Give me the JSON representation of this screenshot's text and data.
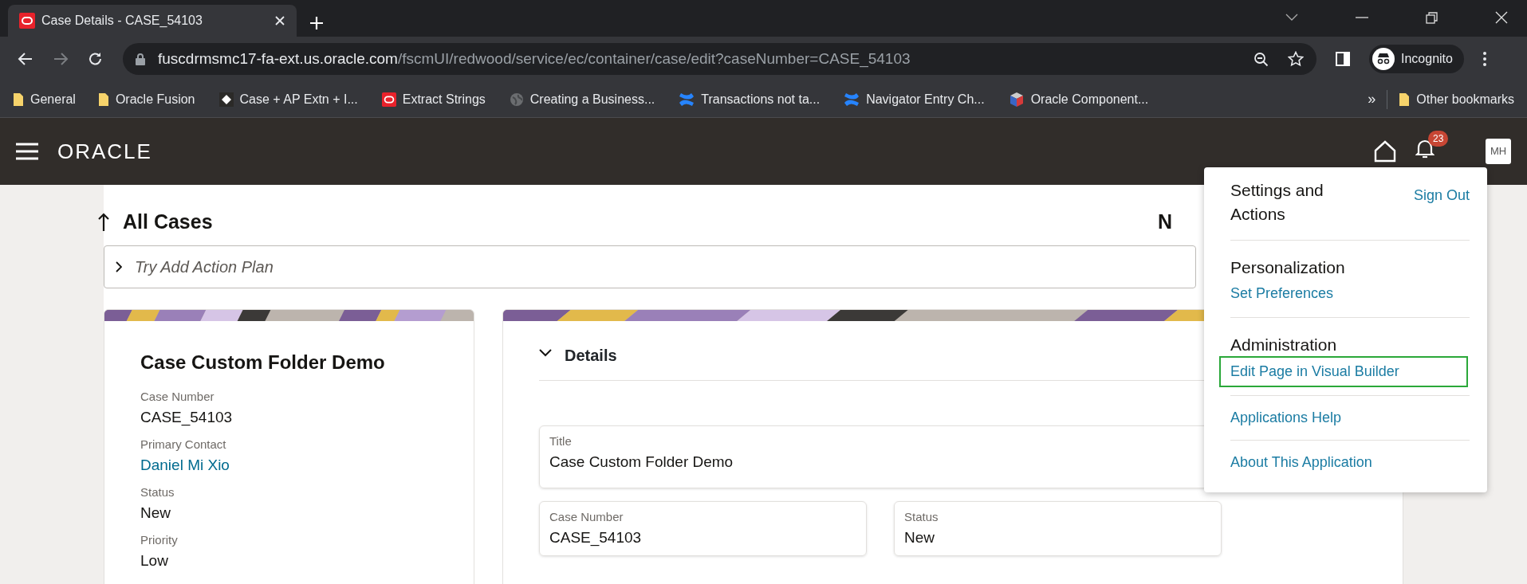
{
  "browser": {
    "tab": {
      "title": "Case Details - CASE_54103"
    },
    "url": {
      "domain": "fuscdrmsmc17-fa-ext.us.oracle.com",
      "path": "/fscmUI/redwood/service/ec/container/case/edit?caseNumber=CASE_54103"
    },
    "profile": "Incognito",
    "bookmarks": [
      {
        "kind": "folder",
        "label": "General"
      },
      {
        "kind": "folder",
        "label": "Oracle Fusion"
      },
      {
        "kind": "diamond",
        "label": "Case + AP Extn + I..."
      },
      {
        "kind": "oracle",
        "label": "Extract Strings"
      },
      {
        "kind": "globe",
        "label": "Creating a Business..."
      },
      {
        "kind": "confluence",
        "label": "Transactions not ta..."
      },
      {
        "kind": "confluence",
        "label": "Navigator Entry Ch..."
      },
      {
        "kind": "cube",
        "label": "Oracle Component..."
      }
    ],
    "bookmarks_overflow": "»",
    "other_bookmarks": "Other bookmarks"
  },
  "app_header": {
    "logo": "ORACLE",
    "notification_count": "23",
    "avatar": "MH"
  },
  "page": {
    "back_title": "All Cases",
    "header_action": "N",
    "action_plan": "Try Add Action Plan",
    "summary_card": {
      "title": "Case Custom Folder Demo",
      "fields": [
        {
          "kind": "text",
          "label": "Case Number",
          "value": "CASE_54103"
        },
        {
          "kind": "link",
          "label": "Primary Contact",
          "value": "Daniel Mi Xio"
        },
        {
          "kind": "text",
          "label": "Status",
          "value": "New"
        },
        {
          "kind": "text",
          "label": "Priority",
          "value": "Low"
        }
      ]
    },
    "details": {
      "heading": "Details",
      "expanded": true,
      "fields": [
        {
          "label": "Title",
          "value": "Case Custom Folder Demo",
          "wide": true
        },
        {
          "label": "Case Number",
          "value": "CASE_54103",
          "wide": false
        },
        {
          "label": "Status",
          "value": "New",
          "wide": false
        }
      ]
    }
  },
  "menu": {
    "title": "Settings and Actions",
    "sign_out": "Sign Out",
    "sections": [
      {
        "heading": "Personalization",
        "items": [
          {
            "label": "Set Preferences",
            "highlighted": false
          }
        ]
      },
      {
        "heading": "Administration",
        "items": [
          {
            "label": "Edit Page in Visual Builder",
            "highlighted": true
          }
        ]
      },
      {
        "items": [
          {
            "label": "Applications Help",
            "highlighted": false
          }
        ]
      },
      {
        "items": [
          {
            "label": "About This Application",
            "highlighted": false
          }
        ]
      }
    ]
  }
}
